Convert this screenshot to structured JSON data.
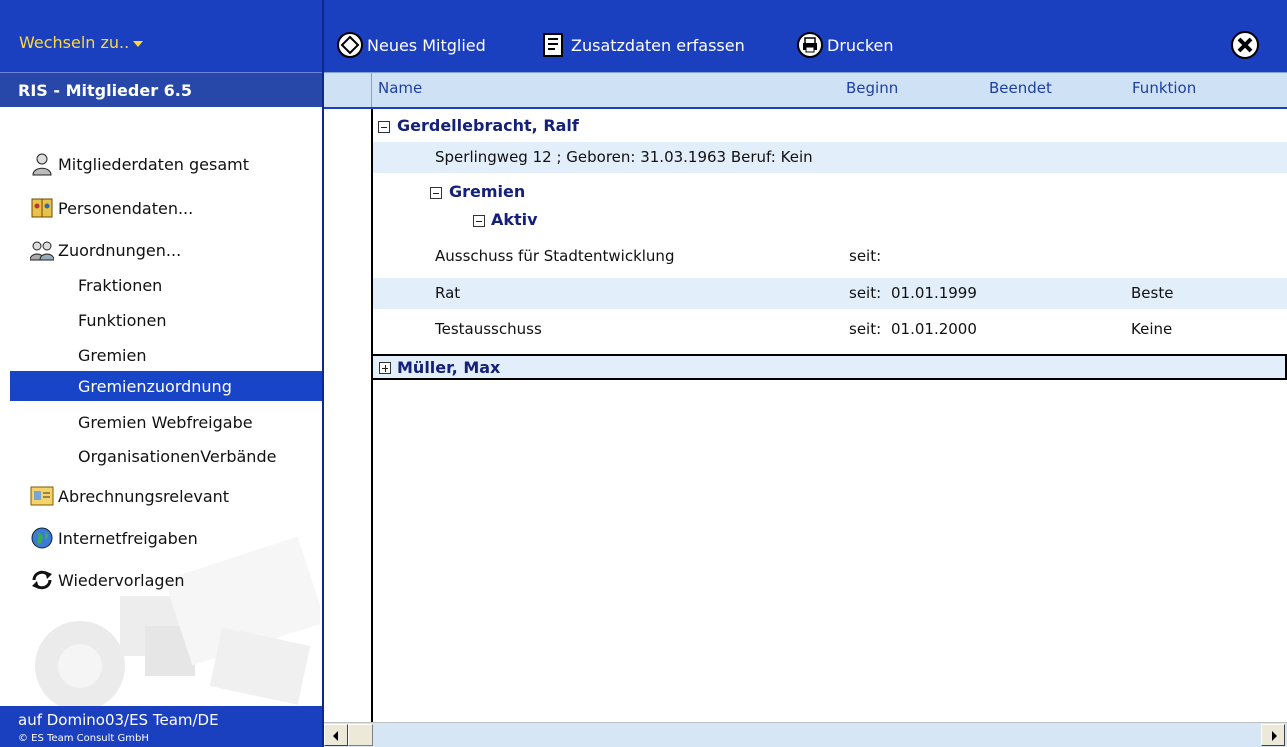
{
  "sidebar": {
    "switch_label": "Wechseln zu..",
    "app_title": "RIS - Mitglieder 6.5",
    "items": [
      {
        "label": "Mitgliederdaten gesamt",
        "icon": "person-icon"
      },
      {
        "label": "Personendaten...",
        "icon": "address-book-icon"
      },
      {
        "label": "Zuordnungen...",
        "icon": "people-icon"
      }
    ],
    "sub_items": [
      {
        "label": "Fraktionen"
      },
      {
        "label": "Funktionen"
      },
      {
        "label": "Gremien"
      },
      {
        "label": "Gremienzuordnung",
        "active": true
      },
      {
        "label": "Gremien Webfreigabe"
      },
      {
        "label": "OrganisationenVerbände"
      }
    ],
    "items2": [
      {
        "label": "Abrechnungsrelevant",
        "icon": "id-card-icon"
      },
      {
        "label": "Internetfreigaben",
        "icon": "globe-icon"
      },
      {
        "label": "Wiedervorlagen",
        "icon": "refresh-icon"
      }
    ],
    "server_line": "auf Domino03/ES Team/DE",
    "copyright": "© ES Team Consult GmbH"
  },
  "toolbar": {
    "new_member": "Neues Mitglied",
    "additional_data": "Zusatzdaten erfassen",
    "print": "Drucken"
  },
  "columns": {
    "name": "Name",
    "begin": "Beginn",
    "end": "Beendet",
    "function": "Funktion"
  },
  "rows": {
    "person1": "Gerdellebracht, Ralf",
    "person1_details": "Sperlingweg 12 ; Geboren: 31.03.1963 Beruf: Kein",
    "group": "Gremien",
    "status": "Aktiv",
    "entries": [
      {
        "name": "Ausschuss für Stadtentwicklung",
        "since": "seit:",
        "date": "",
        "function": ""
      },
      {
        "name": "Rat",
        "since": "seit:",
        "date": "01.01.1999",
        "function": "Beste"
      },
      {
        "name": "Testausschuss",
        "since": "seit:",
        "date": "01.01.2000",
        "function": "Keine"
      }
    ],
    "person2": "Müller, Max"
  },
  "colors": {
    "brand_blue": "#1a3fbf",
    "header_blue": "#cfe2f5",
    "category_text": "#14207a",
    "active_item": "#1844c8",
    "switch_text": "#ffd93a"
  }
}
